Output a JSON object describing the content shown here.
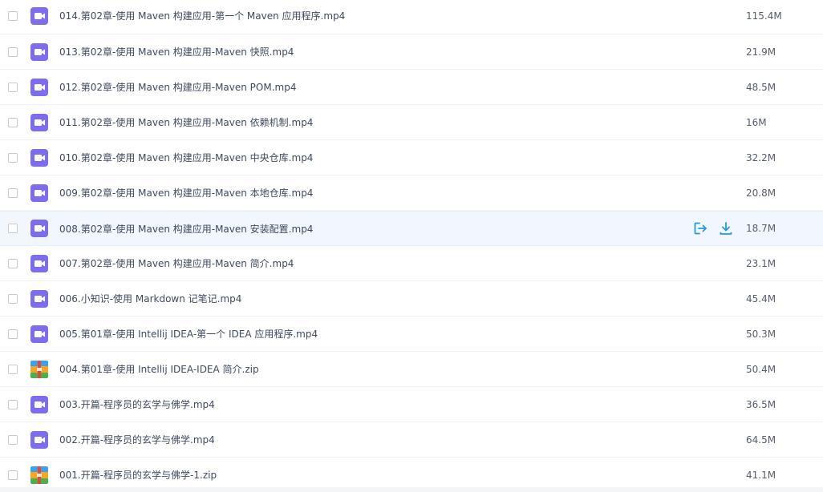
{
  "colors": {
    "video_icon": "#7c6cf0",
    "action_blue": "#1e9bf0",
    "hover_row": "#f1f7fd"
  },
  "files": [
    {
      "name": "014.第02章-使用 Maven 构建应用-第一个 Maven 应用程序.mp4",
      "size": "115.4M",
      "type": "video-icon"
    },
    {
      "name": "013.第02章-使用 Maven 构建应用-Maven 快照.mp4",
      "size": "21.9M",
      "type": "video-icon"
    },
    {
      "name": "012.第02章-使用 Maven 构建应用-Maven POM.mp4",
      "size": "48.5M",
      "type": "video-icon"
    },
    {
      "name": "011.第02章-使用 Maven 构建应用-Maven 依赖机制.mp4",
      "size": "16M",
      "type": "video-icon"
    },
    {
      "name": "010.第02章-使用 Maven 构建应用-Maven 中央仓库.mp4",
      "size": "32.2M",
      "type": "video-icon"
    },
    {
      "name": "009.第02章-使用 Maven 构建应用-Maven 本地仓库.mp4",
      "size": "20.8M",
      "type": "video-icon"
    },
    {
      "name": "008.第02章-使用 Maven 构建应用-Maven 安装配置.mp4",
      "size": "18.7M",
      "type": "video-icon",
      "hovered": true
    },
    {
      "name": "007.第02章-使用 Maven 构建应用-Maven 简介.mp4",
      "size": "23.1M",
      "type": "video-icon"
    },
    {
      "name": "006.小知识-使用 Markdown 记笔记.mp4",
      "size": "45.4M",
      "type": "video-icon"
    },
    {
      "name": "005.第01章-使用 Intellij IDEA-第一个 IDEA 应用程序.mp4",
      "size": "50.3M",
      "type": "video-icon"
    },
    {
      "name": "004.第01章-使用 Intellij IDEA-IDEA 简介.zip",
      "size": "50.4M",
      "type": "zip-icon"
    },
    {
      "name": "003.开篇-程序员的玄学与佛学.mp4",
      "size": "36.5M",
      "type": "video-icon"
    },
    {
      "name": "002.开篇-程序员的玄学与佛学.mp4",
      "size": "64.5M",
      "type": "video-icon"
    },
    {
      "name": "001.开篇-程序员的玄学与佛学-1.zip",
      "size": "41.1M",
      "type": "zip-icon"
    }
  ],
  "row_actions": {
    "share_icon": "share-icon",
    "download_icon": "download-icon"
  }
}
